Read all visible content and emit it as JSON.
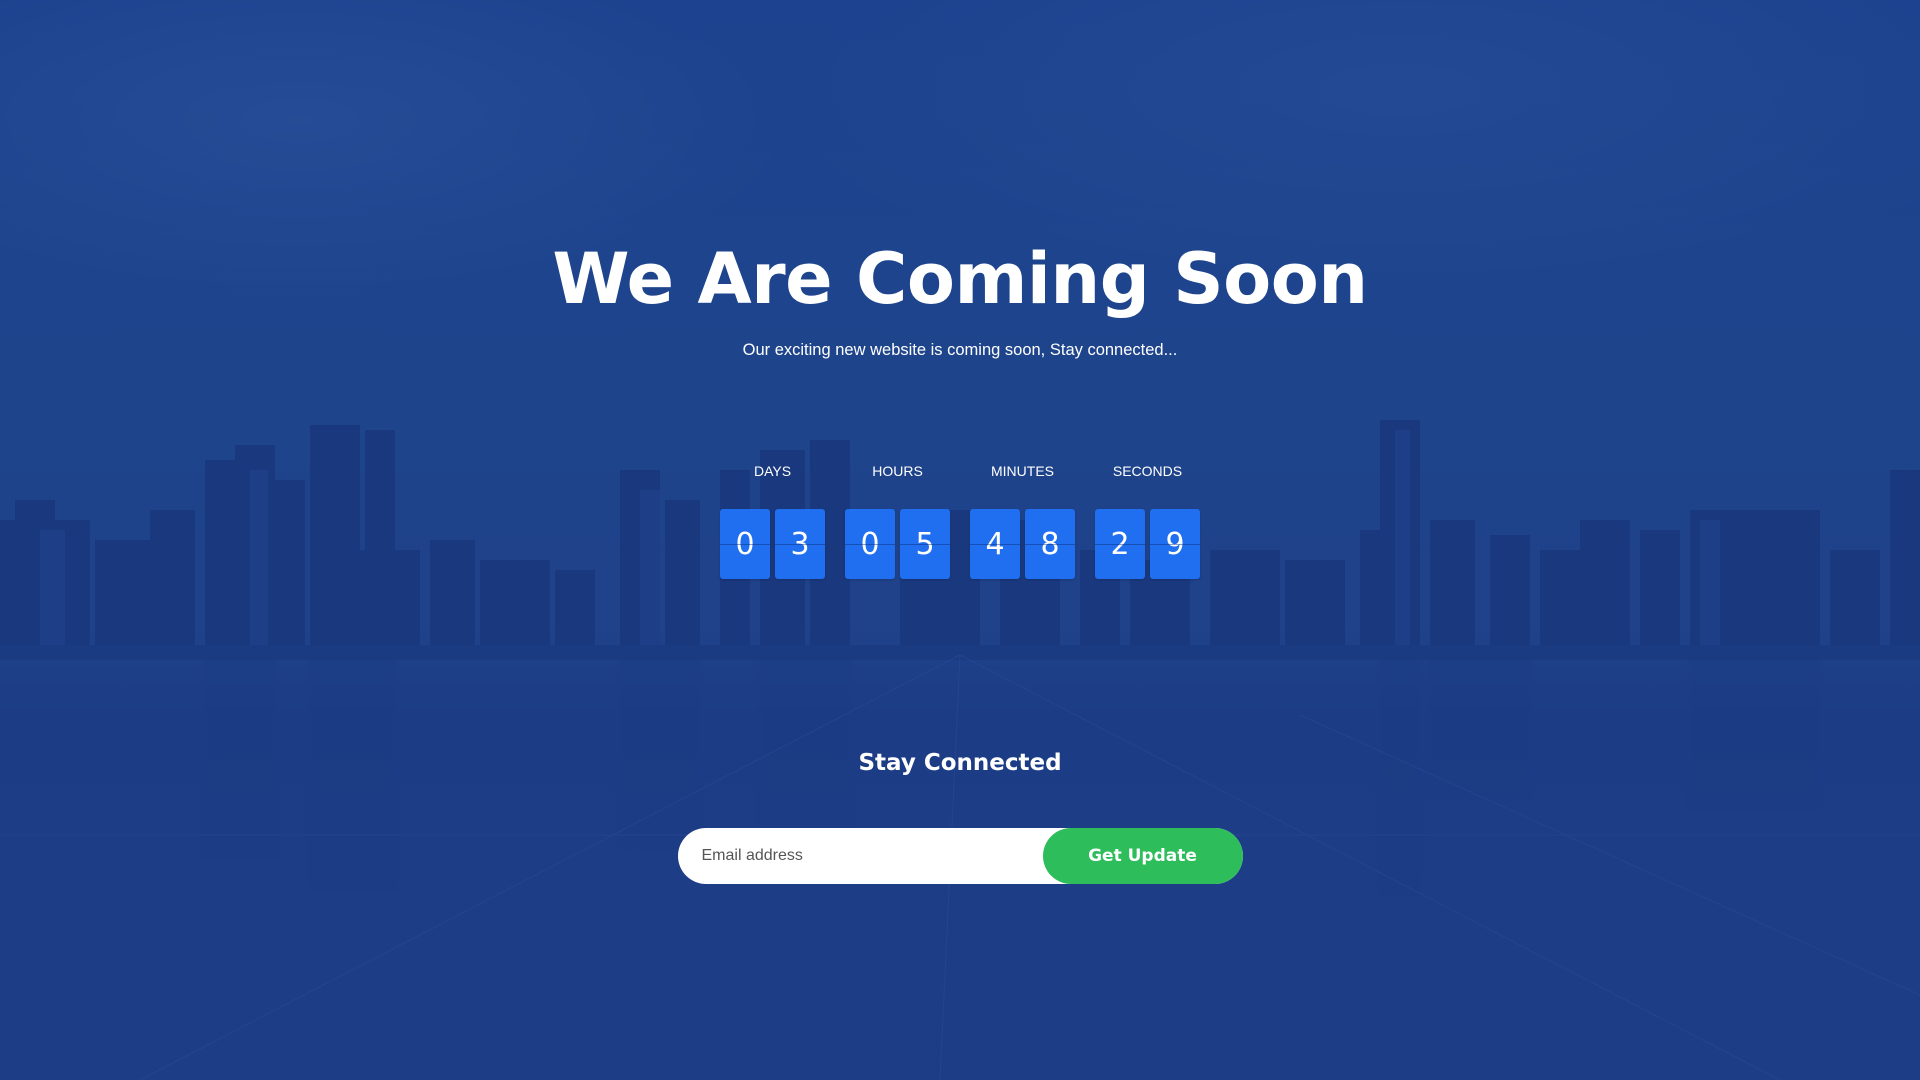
{
  "hero": {
    "title": "We Are Coming Soon",
    "subtitle": "Our exciting new website is coming soon, Stay connected..."
  },
  "countdown": {
    "units": [
      {
        "label": "DAYS",
        "digits": [
          "0",
          "3"
        ]
      },
      {
        "label": "HOURS",
        "digits": [
          "0",
          "5"
        ]
      },
      {
        "label": "MINUTES",
        "digits": [
          "4",
          "8"
        ]
      },
      {
        "label": "SECONDS",
        "digits": [
          "2",
          "9"
        ]
      }
    ]
  },
  "subscribe": {
    "title": "Stay Connected",
    "email_placeholder": "Email address",
    "button_label": "Get Update"
  },
  "colors": {
    "overlay": "#1c3c8a",
    "digit_bg": "#1f6ff0",
    "button_bg": "#2ebd5b",
    "text": "#ffffff"
  }
}
